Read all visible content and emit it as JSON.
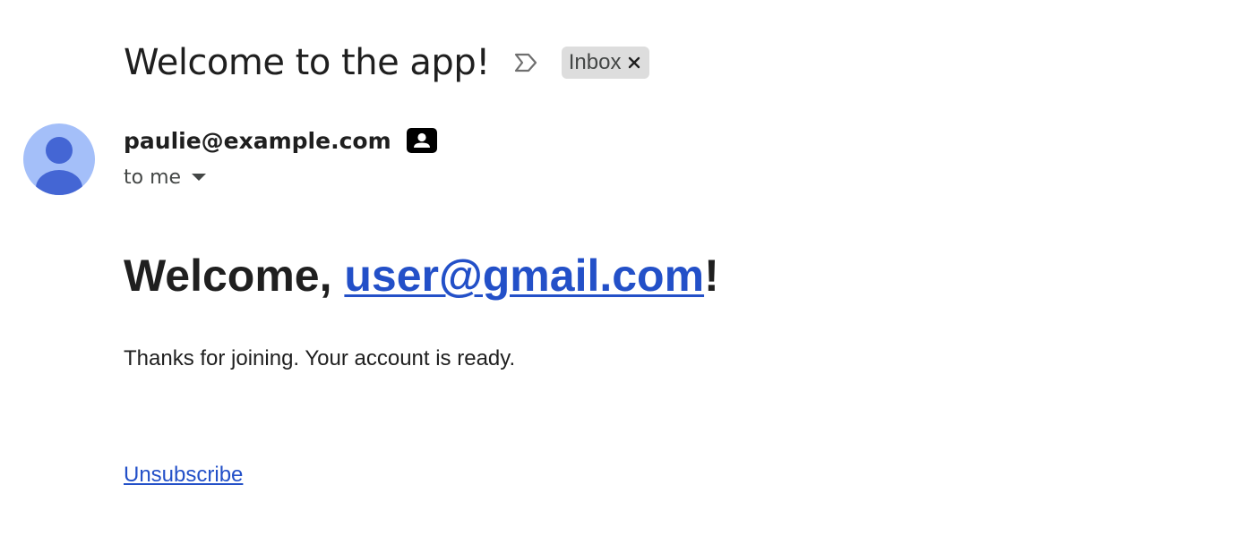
{
  "email": {
    "subject": "Welcome to the app!",
    "label": "Inbox",
    "sender": "paulie@example.com",
    "recipient": "to me"
  },
  "body": {
    "greeting_prefix": "Welcome, ",
    "greeting_email": "user@gmail.com",
    "greeting_suffix": "!",
    "message": "Thanks for joining. Your account is ready.",
    "unsubscribe": "Unsubscribe"
  },
  "icons": {
    "importance": "label-important-outline-icon",
    "label_close": "close-icon",
    "contact": "contact-card-icon",
    "recipient_dropdown": "caret-down-icon",
    "avatar": "person-icon"
  },
  "colors": {
    "link": "#2350c8",
    "chip_bg": "#dddddd",
    "avatar_bg": "#a4bff9",
    "avatar_fg": "#4466d4",
    "text": "#1f1f1f",
    "muted": "#444746"
  }
}
